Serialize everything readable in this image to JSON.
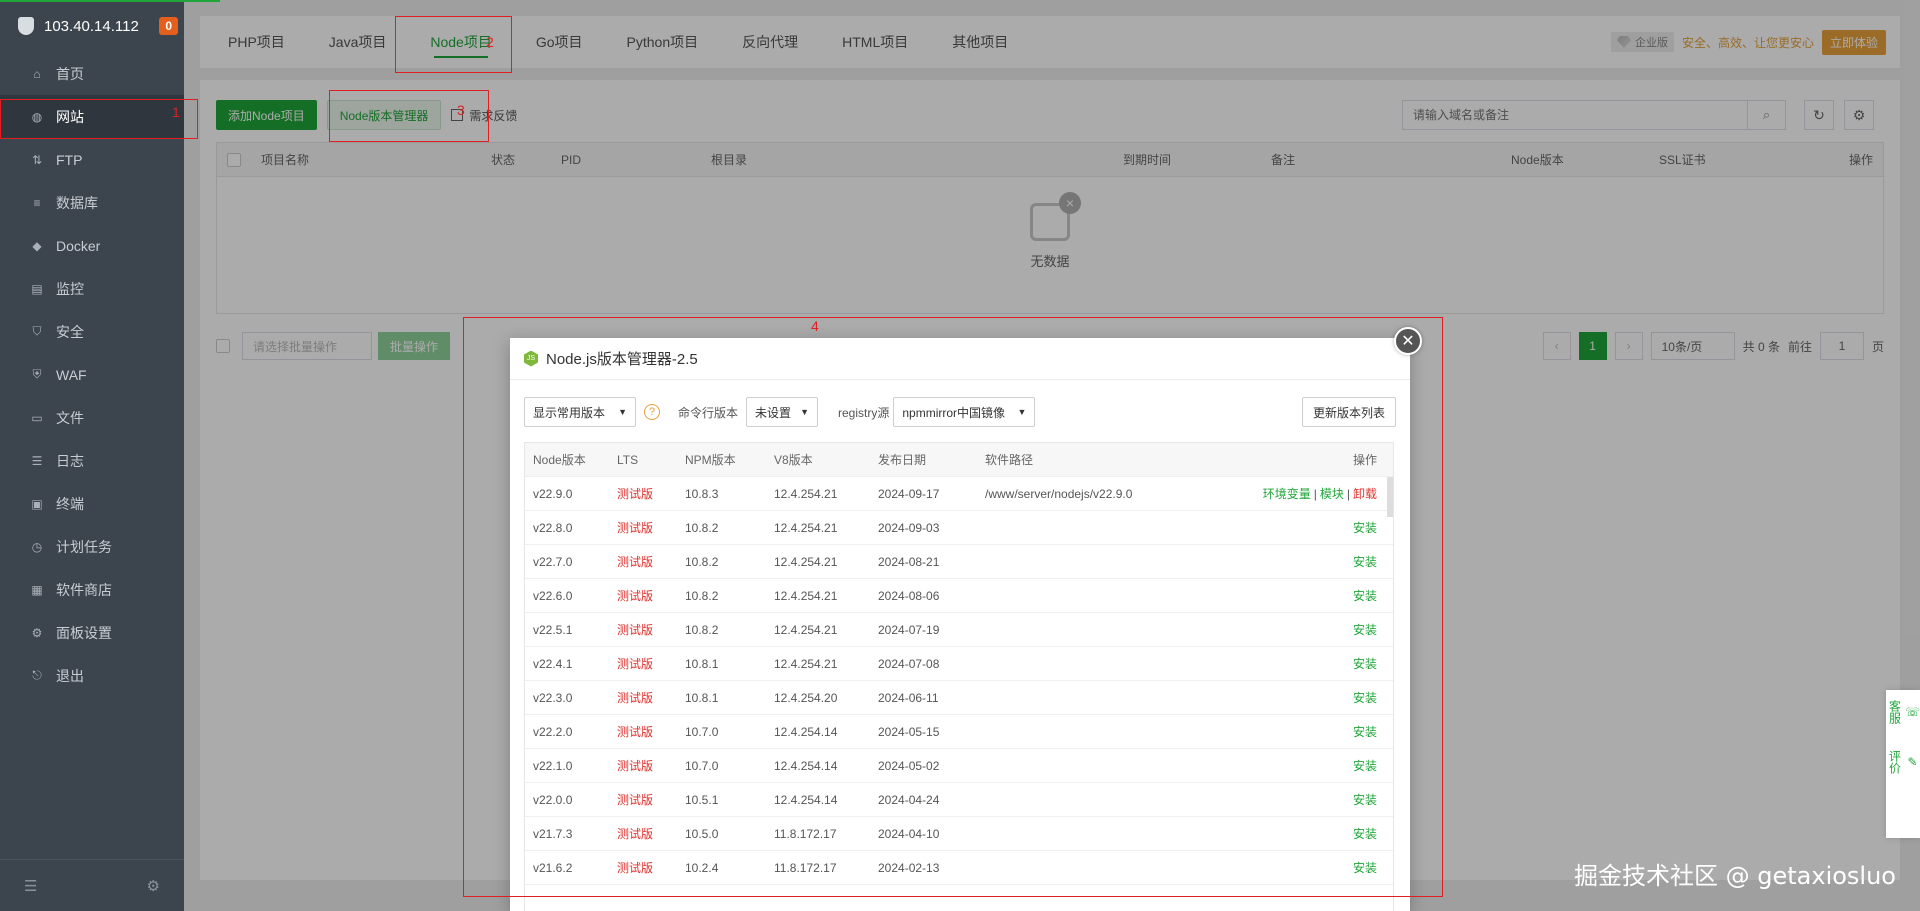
{
  "server": {
    "ip": "103.40.14.112",
    "badge": "0"
  },
  "sidebar": {
    "items": [
      {
        "label": "首页",
        "icon": "home-icon",
        "glyph": "⌂"
      },
      {
        "label": "网站",
        "icon": "globe-icon",
        "glyph": "◍"
      },
      {
        "label": "FTP",
        "icon": "ftp-icon",
        "glyph": "⇅"
      },
      {
        "label": "数据库",
        "icon": "database-icon",
        "glyph": "≡"
      },
      {
        "label": "Docker",
        "icon": "docker-icon",
        "glyph": "◆"
      },
      {
        "label": "监控",
        "icon": "monitor-icon",
        "glyph": "▤"
      },
      {
        "label": "安全",
        "icon": "shield-icon",
        "glyph": "⛉"
      },
      {
        "label": "WAF",
        "icon": "waf-icon",
        "glyph": "⛨"
      },
      {
        "label": "文件",
        "icon": "folder-icon",
        "glyph": "▭"
      },
      {
        "label": "日志",
        "icon": "log-icon",
        "glyph": "☰"
      },
      {
        "label": "终端",
        "icon": "terminal-icon",
        "glyph": "▣"
      },
      {
        "label": "计划任务",
        "icon": "clock-icon",
        "glyph": "◷"
      },
      {
        "label": "软件商店",
        "icon": "apps-icon",
        "glyph": "▦"
      },
      {
        "label": "面板设置",
        "icon": "gear-icon",
        "glyph": "⚙"
      },
      {
        "label": "退出",
        "icon": "logout-icon",
        "glyph": "⎋"
      }
    ],
    "active_index": 1
  },
  "tabs": [
    "PHP项目",
    "Java项目",
    "Node项目",
    "Go项目",
    "Python项目",
    "反向代理",
    "HTML项目",
    "其他项目"
  ],
  "active_tab": 2,
  "enterprise": {
    "badge": "企业版",
    "message": "安全、高效、让您更安心",
    "cta": "立即体验"
  },
  "toolbar": {
    "add": "添加Node项目",
    "manager": "Node版本管理器",
    "feedback": "需求反馈"
  },
  "search": {
    "placeholder": "请输入域名或备注"
  },
  "grid": {
    "columns": [
      "项目名称",
      "状态",
      "PID",
      "根目录",
      "到期时间",
      "备注",
      "Node版本",
      "SSL证书",
      "操作"
    ],
    "empty": "无数据"
  },
  "batch": {
    "placeholder": "请选择批量操作",
    "button": "批量操作"
  },
  "pager": {
    "current": "1",
    "size": "10条/页",
    "total": "共 0 条",
    "goto": "前往",
    "page": "1",
    "suffix": "页"
  },
  "modal": {
    "title": "Node.js版本管理器-2.5",
    "filter": "显示常用版本",
    "cli_label": "命令行版本",
    "cli_value": "未设置",
    "registry_label": "registry源",
    "registry_value": "npmmirror中国镜像",
    "refresh": "更新版本列表",
    "columns": [
      "Node版本",
      "LTS",
      "NPM版本",
      "V8版本",
      "发布日期",
      "软件路径",
      "操作"
    ],
    "rows": [
      {
        "node": "v22.9.0",
        "lts": "测试版",
        "npm": "10.8.3",
        "v8": "12.4.254.21",
        "date": "2024-09-17",
        "path": "/www/server/nodejs/v22.9.0",
        "installed": true
      },
      {
        "node": "v22.8.0",
        "lts": "测试版",
        "npm": "10.8.2",
        "v8": "12.4.254.21",
        "date": "2024-09-03",
        "path": "",
        "installed": false
      },
      {
        "node": "v22.7.0",
        "lts": "测试版",
        "npm": "10.8.2",
        "v8": "12.4.254.21",
        "date": "2024-08-21",
        "path": "",
        "installed": false
      },
      {
        "node": "v22.6.0",
        "lts": "测试版",
        "npm": "10.8.2",
        "v8": "12.4.254.21",
        "date": "2024-08-06",
        "path": "",
        "installed": false
      },
      {
        "node": "v22.5.1",
        "lts": "测试版",
        "npm": "10.8.2",
        "v8": "12.4.254.21",
        "date": "2024-07-19",
        "path": "",
        "installed": false
      },
      {
        "node": "v22.4.1",
        "lts": "测试版",
        "npm": "10.8.1",
        "v8": "12.4.254.21",
        "date": "2024-07-08",
        "path": "",
        "installed": false
      },
      {
        "node": "v22.3.0",
        "lts": "测试版",
        "npm": "10.8.1",
        "v8": "12.4.254.20",
        "date": "2024-06-11",
        "path": "",
        "installed": false
      },
      {
        "node": "v22.2.0",
        "lts": "测试版",
        "npm": "10.7.0",
        "v8": "12.4.254.14",
        "date": "2024-05-15",
        "path": "",
        "installed": false
      },
      {
        "node": "v22.1.0",
        "lts": "测试版",
        "npm": "10.7.0",
        "v8": "12.4.254.14",
        "date": "2024-05-02",
        "path": "",
        "installed": false
      },
      {
        "node": "v22.0.0",
        "lts": "测试版",
        "npm": "10.5.1",
        "v8": "12.4.254.14",
        "date": "2024-04-24",
        "path": "",
        "installed": false
      },
      {
        "node": "v21.7.3",
        "lts": "测试版",
        "npm": "10.5.0",
        "v8": "11.8.172.17",
        "date": "2024-04-10",
        "path": "",
        "installed": false
      },
      {
        "node": "v21.6.2",
        "lts": "测试版",
        "npm": "10.2.4",
        "v8": "11.8.172.17",
        "date": "2024-02-13",
        "path": "",
        "installed": false
      }
    ],
    "actions": {
      "env": "环境变量",
      "module": "模块",
      "uninstall": "卸载",
      "install": "安装"
    }
  },
  "annotations": [
    "1",
    "2",
    "3",
    "4"
  ],
  "float": {
    "service": "客服",
    "rate": "评价"
  },
  "watermark": "掘金技术社区 @ getaxiosluo",
  "colors": {
    "brand": "#20a53a",
    "sidebar": "#3c444d",
    "danger": "#e0332f",
    "warning": "#e6a23c"
  }
}
